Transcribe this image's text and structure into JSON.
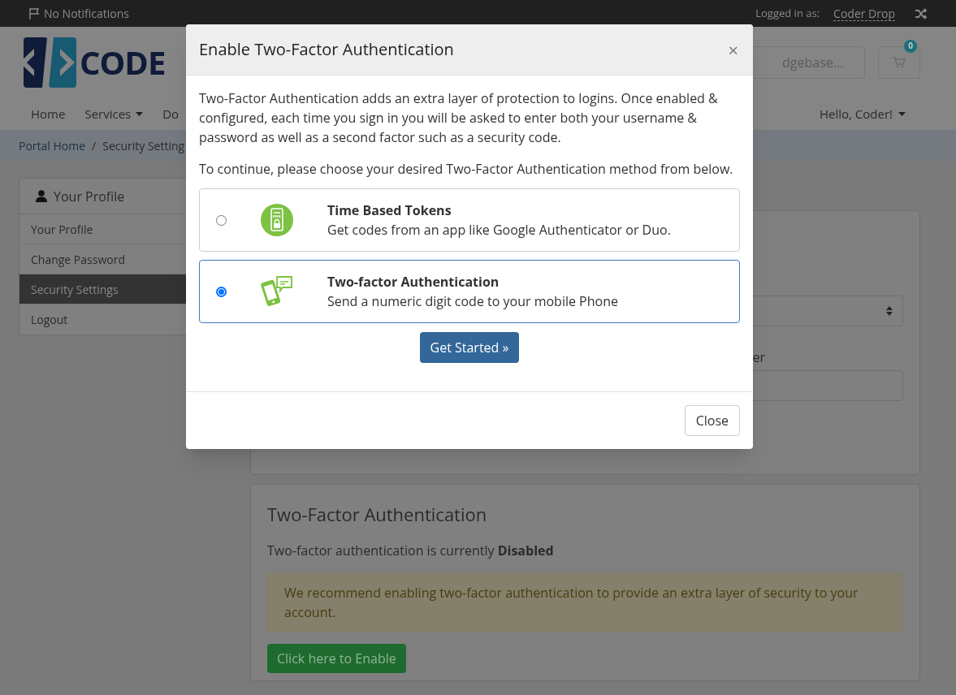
{
  "top_bar": {
    "notifications": "No Notifications",
    "logged_in_label": "Logged in as:",
    "user": "Coder Drop"
  },
  "header": {
    "logo_text": "CODE",
    "search": {
      "placeholder": "dgebase..."
    },
    "cart_count": "0"
  },
  "nav": {
    "items": [
      {
        "label": "Home",
        "dropdown": false
      },
      {
        "label": "Services",
        "dropdown": true
      },
      {
        "label": "Do",
        "dropdown": false
      }
    ],
    "greeting": "Hello, Coder!"
  },
  "breadcrumb": {
    "separator": "/",
    "items": [
      "Portal Home",
      "Security Setting"
    ]
  },
  "sidebar": {
    "title": "Your Profile",
    "items": [
      {
        "label": "Your Profile",
        "selected": false
      },
      {
        "label": "Change Password",
        "selected": false
      },
      {
        "label": "Security Settings",
        "selected": true
      },
      {
        "label": "Logout",
        "selected": false
      }
    ]
  },
  "main": {
    "field_label": "er"
  },
  "two_factor": {
    "title": "Two-Factor Authentication",
    "status": "Two-factor authentication is currently **Disabled**",
    "alert": "We recommend enabling two-factor authentication to provide an extra layer of security to your account.",
    "button": "Click here to Enable"
  },
  "modal": {
    "title": "Enable Two-Factor Authentication",
    "close_icon": "×",
    "intro": "Two-Factor Authentication adds an extra layer of protection to logins. Once enabled & configured, each time you sign in you will be asked to enter both your username & password as well as a second factor such as a security code.",
    "prompt": "To continue, please choose your desired Two-Factor Authentication method from below.",
    "methods": [
      {
        "kind": "totp",
        "title": "Time Based Tokens",
        "description": "Get codes from an app like Google Authenticator or Duo.",
        "selected": false
      },
      {
        "kind": "sms",
        "title": "Two-factor Authentication",
        "description": "Send a numeric digit code to your mobile Phone",
        "selected": true
      }
    ],
    "primary_button": "Get Started »",
    "close_button": "Close"
  }
}
